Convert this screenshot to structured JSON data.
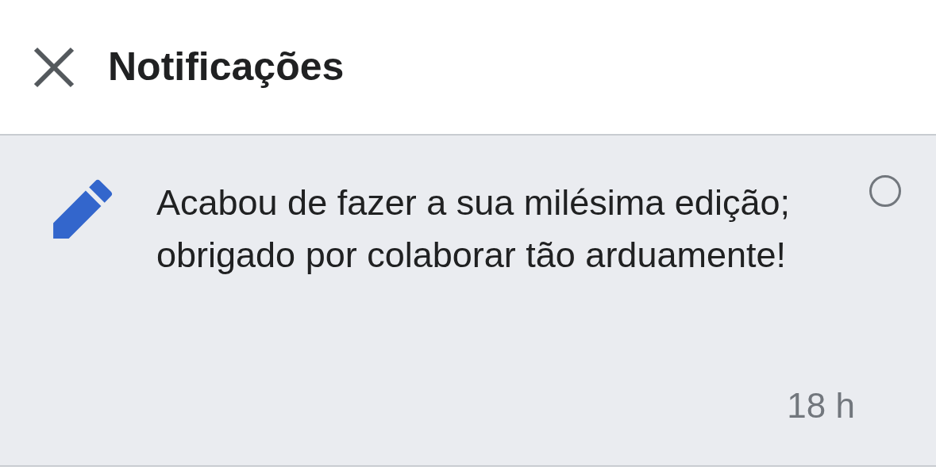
{
  "header": {
    "title": "Notificações"
  },
  "notifications": [
    {
      "kind": "edit",
      "text": "Acabou de fazer a sua milésima edição; obrigado por colaborar tão arduamente!",
      "time": "18 h",
      "read": true
    }
  ]
}
